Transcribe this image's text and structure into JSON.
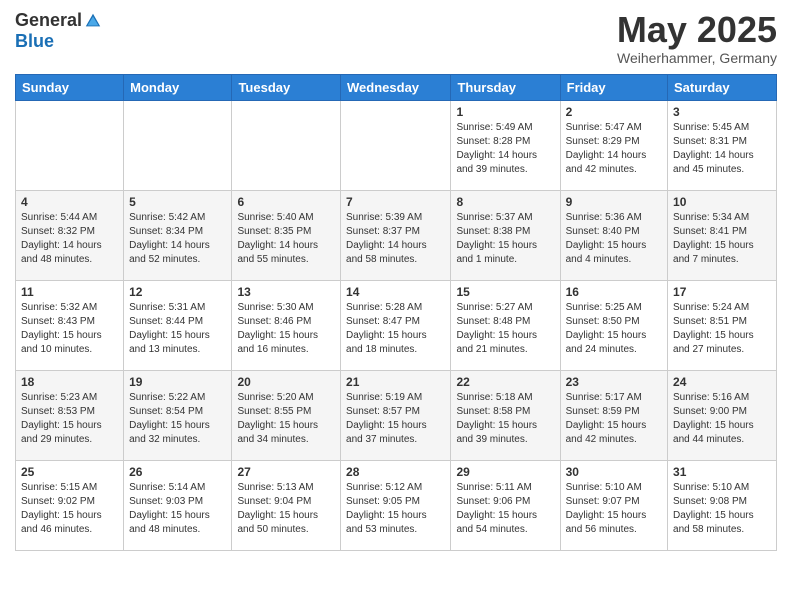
{
  "header": {
    "logo_general": "General",
    "logo_blue": "Blue",
    "month_title": "May 2025",
    "location": "Weiherhammer, Germany"
  },
  "days_of_week": [
    "Sunday",
    "Monday",
    "Tuesday",
    "Wednesday",
    "Thursday",
    "Friday",
    "Saturday"
  ],
  "weeks": [
    [
      {
        "day": "",
        "info": ""
      },
      {
        "day": "",
        "info": ""
      },
      {
        "day": "",
        "info": ""
      },
      {
        "day": "",
        "info": ""
      },
      {
        "day": "1",
        "info": "Sunrise: 5:49 AM\nSunset: 8:28 PM\nDaylight: 14 hours\nand 39 minutes."
      },
      {
        "day": "2",
        "info": "Sunrise: 5:47 AM\nSunset: 8:29 PM\nDaylight: 14 hours\nand 42 minutes."
      },
      {
        "day": "3",
        "info": "Sunrise: 5:45 AM\nSunset: 8:31 PM\nDaylight: 14 hours\nand 45 minutes."
      }
    ],
    [
      {
        "day": "4",
        "info": "Sunrise: 5:44 AM\nSunset: 8:32 PM\nDaylight: 14 hours\nand 48 minutes."
      },
      {
        "day": "5",
        "info": "Sunrise: 5:42 AM\nSunset: 8:34 PM\nDaylight: 14 hours\nand 52 minutes."
      },
      {
        "day": "6",
        "info": "Sunrise: 5:40 AM\nSunset: 8:35 PM\nDaylight: 14 hours\nand 55 minutes."
      },
      {
        "day": "7",
        "info": "Sunrise: 5:39 AM\nSunset: 8:37 PM\nDaylight: 14 hours\nand 58 minutes."
      },
      {
        "day": "8",
        "info": "Sunrise: 5:37 AM\nSunset: 8:38 PM\nDaylight: 15 hours\nand 1 minute."
      },
      {
        "day": "9",
        "info": "Sunrise: 5:36 AM\nSunset: 8:40 PM\nDaylight: 15 hours\nand 4 minutes."
      },
      {
        "day": "10",
        "info": "Sunrise: 5:34 AM\nSunset: 8:41 PM\nDaylight: 15 hours\nand 7 minutes."
      }
    ],
    [
      {
        "day": "11",
        "info": "Sunrise: 5:32 AM\nSunset: 8:43 PM\nDaylight: 15 hours\nand 10 minutes."
      },
      {
        "day": "12",
        "info": "Sunrise: 5:31 AM\nSunset: 8:44 PM\nDaylight: 15 hours\nand 13 minutes."
      },
      {
        "day": "13",
        "info": "Sunrise: 5:30 AM\nSunset: 8:46 PM\nDaylight: 15 hours\nand 16 minutes."
      },
      {
        "day": "14",
        "info": "Sunrise: 5:28 AM\nSunset: 8:47 PM\nDaylight: 15 hours\nand 18 minutes."
      },
      {
        "day": "15",
        "info": "Sunrise: 5:27 AM\nSunset: 8:48 PM\nDaylight: 15 hours\nand 21 minutes."
      },
      {
        "day": "16",
        "info": "Sunrise: 5:25 AM\nSunset: 8:50 PM\nDaylight: 15 hours\nand 24 minutes."
      },
      {
        "day": "17",
        "info": "Sunrise: 5:24 AM\nSunset: 8:51 PM\nDaylight: 15 hours\nand 27 minutes."
      }
    ],
    [
      {
        "day": "18",
        "info": "Sunrise: 5:23 AM\nSunset: 8:53 PM\nDaylight: 15 hours\nand 29 minutes."
      },
      {
        "day": "19",
        "info": "Sunrise: 5:22 AM\nSunset: 8:54 PM\nDaylight: 15 hours\nand 32 minutes."
      },
      {
        "day": "20",
        "info": "Sunrise: 5:20 AM\nSunset: 8:55 PM\nDaylight: 15 hours\nand 34 minutes."
      },
      {
        "day": "21",
        "info": "Sunrise: 5:19 AM\nSunset: 8:57 PM\nDaylight: 15 hours\nand 37 minutes."
      },
      {
        "day": "22",
        "info": "Sunrise: 5:18 AM\nSunset: 8:58 PM\nDaylight: 15 hours\nand 39 minutes."
      },
      {
        "day": "23",
        "info": "Sunrise: 5:17 AM\nSunset: 8:59 PM\nDaylight: 15 hours\nand 42 minutes."
      },
      {
        "day": "24",
        "info": "Sunrise: 5:16 AM\nSunset: 9:00 PM\nDaylight: 15 hours\nand 44 minutes."
      }
    ],
    [
      {
        "day": "25",
        "info": "Sunrise: 5:15 AM\nSunset: 9:02 PM\nDaylight: 15 hours\nand 46 minutes."
      },
      {
        "day": "26",
        "info": "Sunrise: 5:14 AM\nSunset: 9:03 PM\nDaylight: 15 hours\nand 48 minutes."
      },
      {
        "day": "27",
        "info": "Sunrise: 5:13 AM\nSunset: 9:04 PM\nDaylight: 15 hours\nand 50 minutes."
      },
      {
        "day": "28",
        "info": "Sunrise: 5:12 AM\nSunset: 9:05 PM\nDaylight: 15 hours\nand 53 minutes."
      },
      {
        "day": "29",
        "info": "Sunrise: 5:11 AM\nSunset: 9:06 PM\nDaylight: 15 hours\nand 54 minutes."
      },
      {
        "day": "30",
        "info": "Sunrise: 5:10 AM\nSunset: 9:07 PM\nDaylight: 15 hours\nand 56 minutes."
      },
      {
        "day": "31",
        "info": "Sunrise: 5:10 AM\nSunset: 9:08 PM\nDaylight: 15 hours\nand 58 minutes."
      }
    ]
  ]
}
